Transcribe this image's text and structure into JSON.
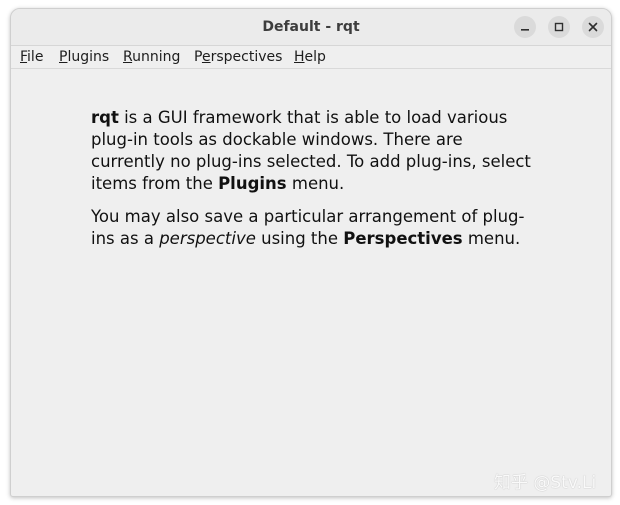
{
  "window": {
    "title": "Default - rqt"
  },
  "menubar": {
    "items": [
      {
        "label_mnemonic": "F",
        "label_rest": "ile"
      },
      {
        "label_mnemonic": "P",
        "label_rest": "lugins"
      },
      {
        "label_mnemonic": "R",
        "label_rest": "unning"
      },
      {
        "label_pre": "P",
        "label_mnemonic": "e",
        "label_rest": "rspectives"
      },
      {
        "label_mnemonic": "H",
        "label_rest": "elp"
      }
    ]
  },
  "main": {
    "paragraph1": {
      "app_name": "rqt",
      "text_a": " is a GUI framework that is able to load various plug-in tools as dockable windows. There are currently no plug-ins selected. To add plug-ins, select items from the ",
      "menu_ref": "Plugins",
      "text_b": " menu."
    },
    "paragraph2": {
      "text_a": "You may also save a particular arrangement of plug-ins as a ",
      "term": "perspective",
      "text_b": " using the ",
      "menu_ref": "Perspectives",
      "text_c": " menu."
    }
  },
  "watermark": {
    "text": "知乎 @Stv.Li"
  },
  "colors": {
    "window_bg": "#efefef",
    "titlebar_bg": "#ebebeb",
    "title_text": "#3d3d3d",
    "window_button_bg": "#dadada",
    "body_text": "#111111"
  },
  "icons": {
    "minimize": "minimize-icon",
    "maximize": "maximize-icon",
    "close": "close-icon"
  }
}
